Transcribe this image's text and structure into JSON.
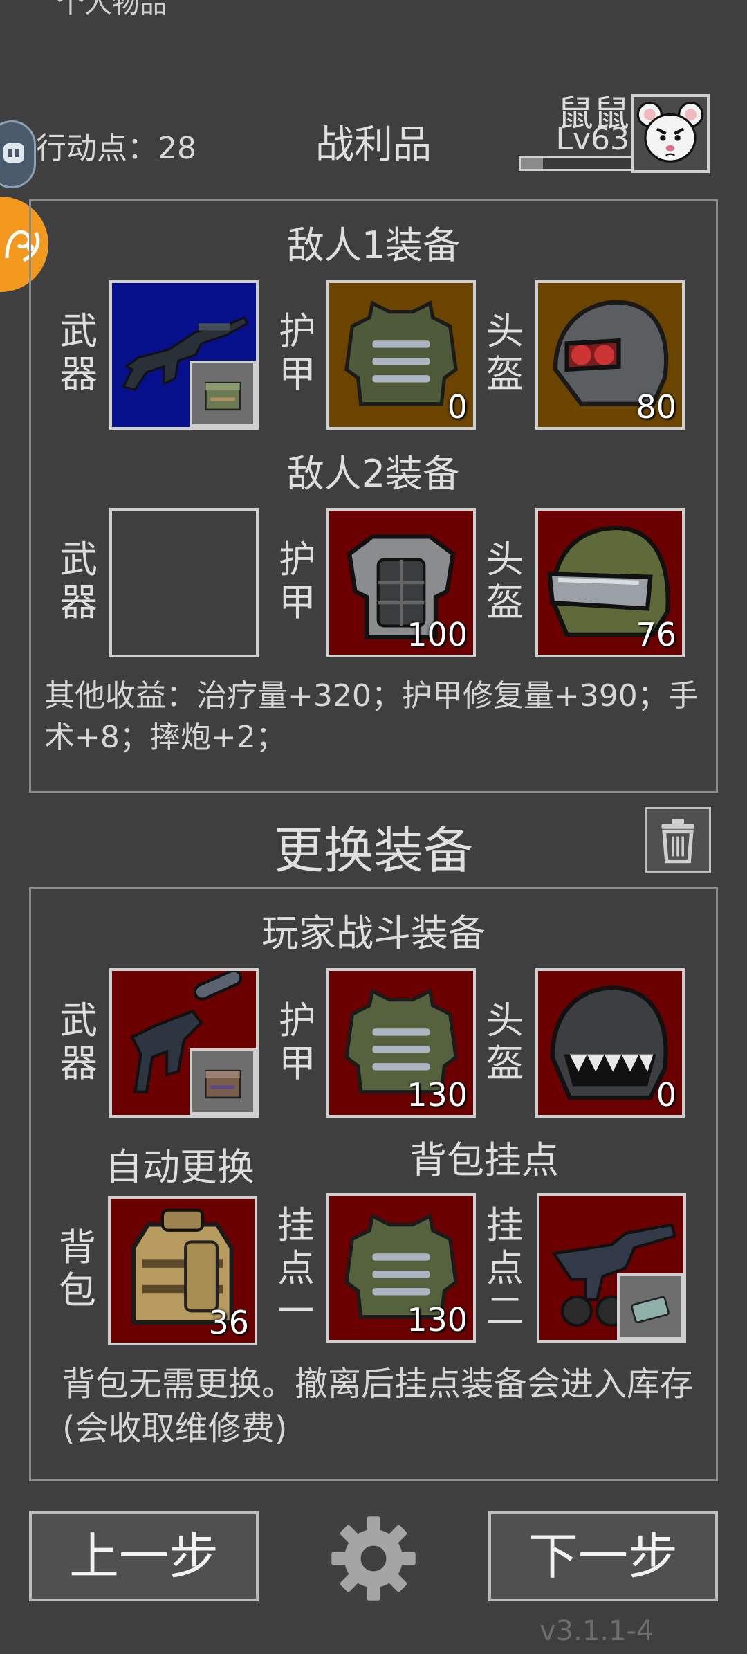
{
  "top_cut_text": "个人物品",
  "header": {
    "action_points_label": "行动点：28",
    "title": "战利品",
    "player_name": "鼠鼠",
    "player_level": "Lv63",
    "xp_fraction": 0.2
  },
  "labels": {
    "weapon": "武器",
    "armor": "护甲",
    "helmet": "头盔",
    "backpack": "背包",
    "mount_one": "挂点一",
    "mount_two": "挂点二"
  },
  "loot": {
    "enemy1_title": "敌人1装备",
    "enemy1": {
      "armor_value": "0",
      "helmet_value": "80"
    },
    "enemy2_title": "敌人2装备",
    "enemy2": {
      "armor_value": "100",
      "helmet_value": "76"
    },
    "other_income": "其他收益：治疗量+320；护甲修复量+390；手术+8；摔炮+2；"
  },
  "change": {
    "title": "更换装备",
    "trash_icon": "trash-icon"
  },
  "player": {
    "title": "玩家战斗装备",
    "armor_value": "130",
    "helmet_value": "0",
    "auto_replace": "自动更换",
    "mount_title": "背包挂点",
    "backpack_value": "36",
    "mount_one_value": "130",
    "note": "背包无需更换。撤离后挂点装备会进入库存(会收取维修费)"
  },
  "footer": {
    "prev": "上一步",
    "next": "下一步",
    "settings_icon": "gear-icon",
    "version": "v3.1.1-4"
  },
  "colors": {
    "bg": "#3f3f3f",
    "slot_red": "#6b0000",
    "slot_blue": "#06108a",
    "slot_brown": "#6b4500",
    "accent_orange": "#f39a1e"
  }
}
